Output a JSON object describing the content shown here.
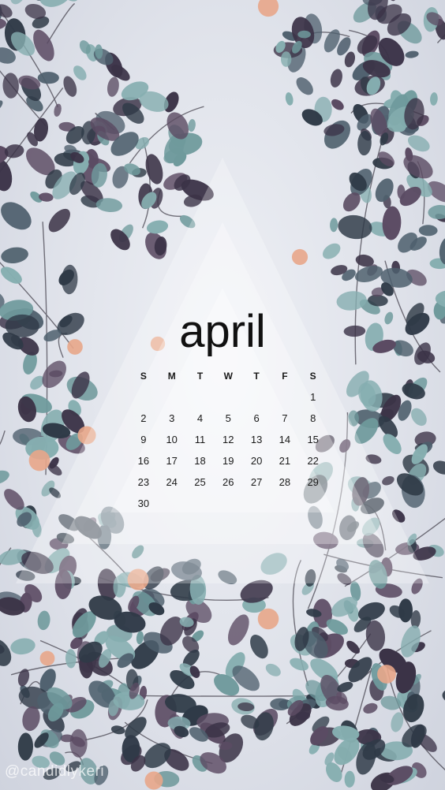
{
  "calendar": {
    "month": "april",
    "weekdays": [
      "S",
      "M",
      "T",
      "W",
      "T",
      "F",
      "S"
    ],
    "weeks": [
      [
        "",
        "",
        "",
        "",
        "",
        "",
        "1"
      ],
      [
        "2",
        "3",
        "4",
        "5",
        "6",
        "7",
        "8"
      ],
      [
        "9",
        "10",
        "11",
        "12",
        "13",
        "14",
        "15"
      ],
      [
        "16",
        "17",
        "18",
        "19",
        "20",
        "21",
        "22"
      ],
      [
        "23",
        "24",
        "25",
        "26",
        "27",
        "28",
        "29"
      ],
      [
        "30",
        "",
        "",
        "",
        "",
        "",
        ""
      ]
    ]
  },
  "watermark": "@candidlykeri",
  "colors": {
    "leaf_dark": "#3b3347",
    "leaf_teal": "#6f9a9c",
    "leaf_mid": "#4e5f6d",
    "flower": "#e8a68a",
    "sky": "#e3e5ec"
  }
}
